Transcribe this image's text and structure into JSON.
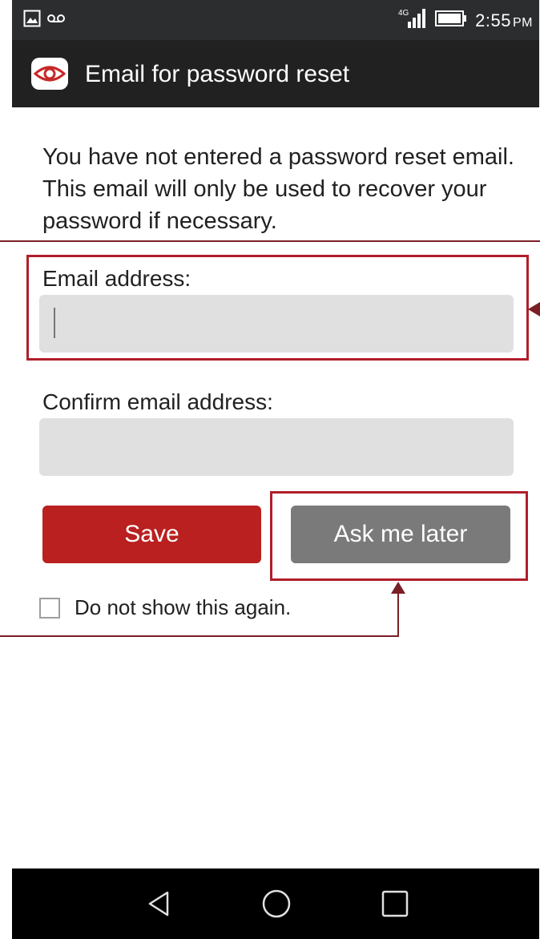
{
  "status_bar": {
    "time": "2:55",
    "ampm": "PM",
    "network": "4G"
  },
  "app_bar": {
    "title": "Email for password reset"
  },
  "main": {
    "intro_text": "You have not entered a password reset email. This email will only be used to recover your password if necessary.",
    "email_label": "Email address:",
    "email_value": "",
    "confirm_label": "Confirm email address:",
    "confirm_value": "",
    "save_label": "Save",
    "later_label": "Ask me later",
    "checkbox_label": "Do not show this again.",
    "checkbox_checked": false
  },
  "colors": {
    "accent_red": "#b9201f",
    "annotation_red": "#b01e2b",
    "button_gray": "#7a7a7a",
    "field_gray": "#e0e0e0"
  },
  "icons": [
    "image-icon",
    "voicemail-icon",
    "signal-icon",
    "battery-icon",
    "app-eye-icon",
    "back-icon",
    "home-icon",
    "recents-icon"
  ]
}
